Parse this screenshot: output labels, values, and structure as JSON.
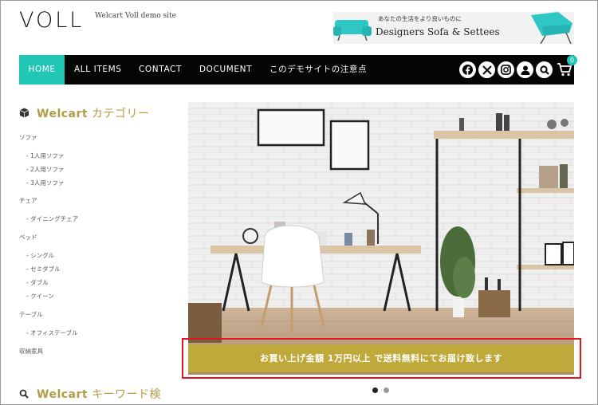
{
  "site": {
    "logo": "VOLL",
    "tagline": "Welcart Voll demo site"
  },
  "banner": {
    "small_text": "あなたの生活をより良いものに",
    "big_text": "Designers Sofa & Settees",
    "accent_color": "#2fc7c6"
  },
  "nav": {
    "items": [
      {
        "label": "HOME",
        "active": true
      },
      {
        "label": "ALL ITEMS"
      },
      {
        "label": "CONTACT"
      },
      {
        "label": "DOCUMENT"
      },
      {
        "label": "このデモサイトの注意点"
      }
    ],
    "active_color": "#22c6b4",
    "icons": [
      "facebook-icon",
      "x-icon",
      "instagram-icon",
      "user-icon",
      "search-icon",
      "cart-icon"
    ],
    "cart_count": "0"
  },
  "sidebar": {
    "category_heading": {
      "brand": "Welcart",
      "rest": " カテゴリー"
    },
    "categories": [
      {
        "label": "ソファ",
        "children": [
          "1人用ソファ",
          "2人用ソファ",
          "3人用ソファ"
        ]
      },
      {
        "label": "チェア",
        "children": [
          "ダイニングチェア"
        ]
      },
      {
        "label": "ベッド",
        "children": [
          "シングル",
          "セミダブル",
          "ダブル",
          "クイーン"
        ]
      },
      {
        "label": "テーブル",
        "children": [
          "オフィステーブル"
        ]
      },
      {
        "label": "収納家具",
        "children": []
      }
    ],
    "keyword_heading": {
      "brand": "Welcart",
      "rest": " キーワード検"
    },
    "heading_color": "#b39c45"
  },
  "slider": {
    "promo_text": "お買い上げ金額 1万円以上 で送料無料にてお届け致します",
    "promo_color": "#bfa93a",
    "dots": [
      {
        "active": true
      },
      {
        "active": false
      }
    ]
  }
}
